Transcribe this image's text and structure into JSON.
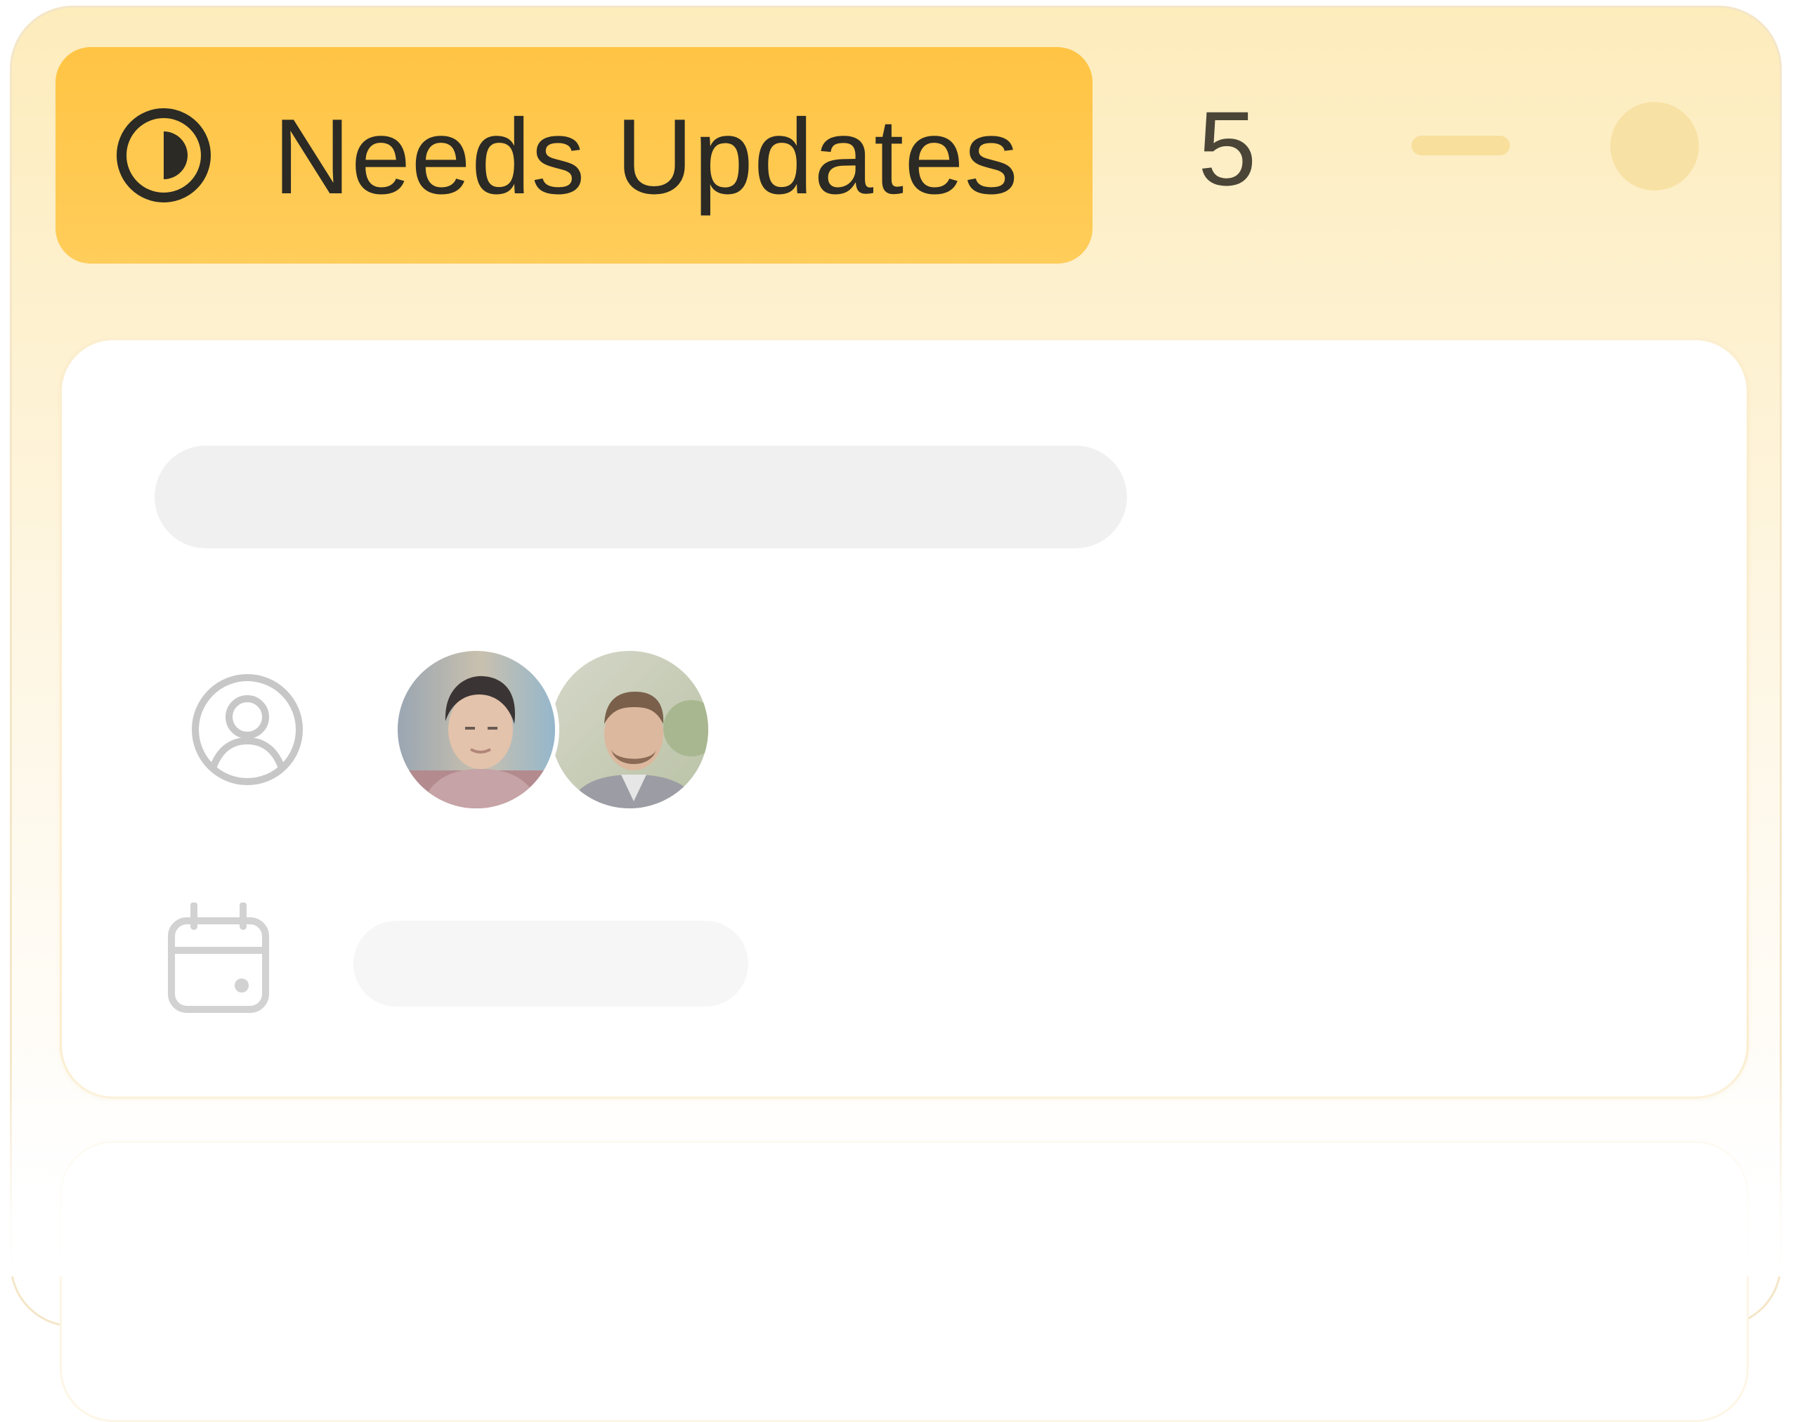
{
  "column": {
    "status": {
      "icon": "half-circle-progress-icon",
      "label": "Needs Updates",
      "color": "#ffc444"
    },
    "count": "5",
    "actions": [
      {
        "icon": "minus-icon"
      },
      {
        "icon": "circle-icon"
      }
    ]
  },
  "card": {
    "assignees_icon": "person-circle-icon",
    "assignees": [
      {
        "avatar": "avatar-photo"
      },
      {
        "avatar": "avatar-photo"
      }
    ],
    "date_icon": "calendar-icon"
  }
}
